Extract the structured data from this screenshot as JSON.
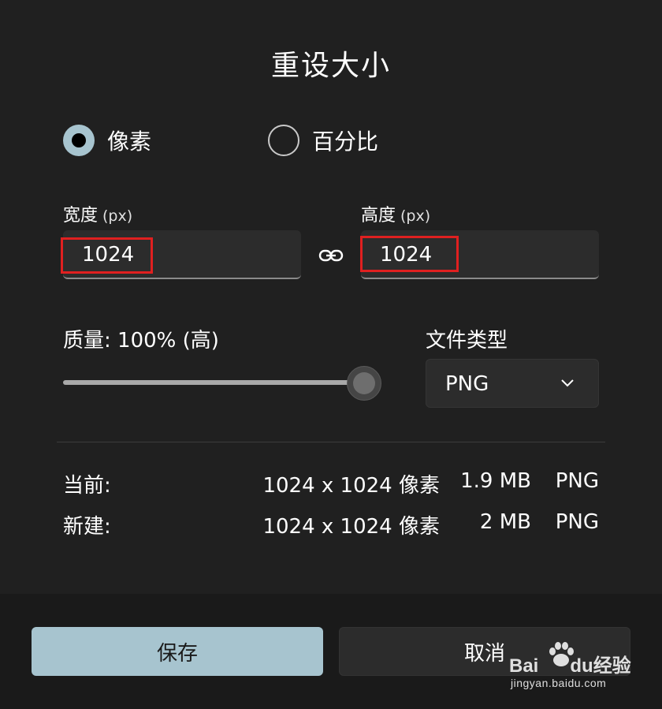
{
  "dialog": {
    "title": "重设大小",
    "mode_options": [
      {
        "label": "像素",
        "selected": true
      },
      {
        "label": "百分比",
        "selected": false
      }
    ],
    "width": {
      "label": "宽度",
      "unit": "(px)",
      "value": "1024"
    },
    "height": {
      "label": "高度",
      "unit": "(px)",
      "value": "1024"
    },
    "link_icon": "link-icon",
    "quality": {
      "label": "质量: 100% (高)",
      "level_percent": 100
    },
    "file_type": {
      "label": "文件类型",
      "selected": "PNG",
      "icon": "chevron-down-icon"
    },
    "info": {
      "current": {
        "label": "当前:",
        "dims": "1024 x 1024 像素",
        "size": "1.9 MB",
        "format": "PNG"
      },
      "new": {
        "label": "新建:",
        "dims": "1024 x 1024 像素",
        "size": "2 MB",
        "format": "PNG"
      }
    },
    "buttons": {
      "save": "保存",
      "cancel": "取消"
    },
    "accent_color": "#a7c4cf",
    "highlight_color": "#e02020"
  },
  "watermark": {
    "brand_a": "Bai",
    "brand_b": "du",
    "brand_c": "经验",
    "sub": "jingyan.baidu.com"
  }
}
